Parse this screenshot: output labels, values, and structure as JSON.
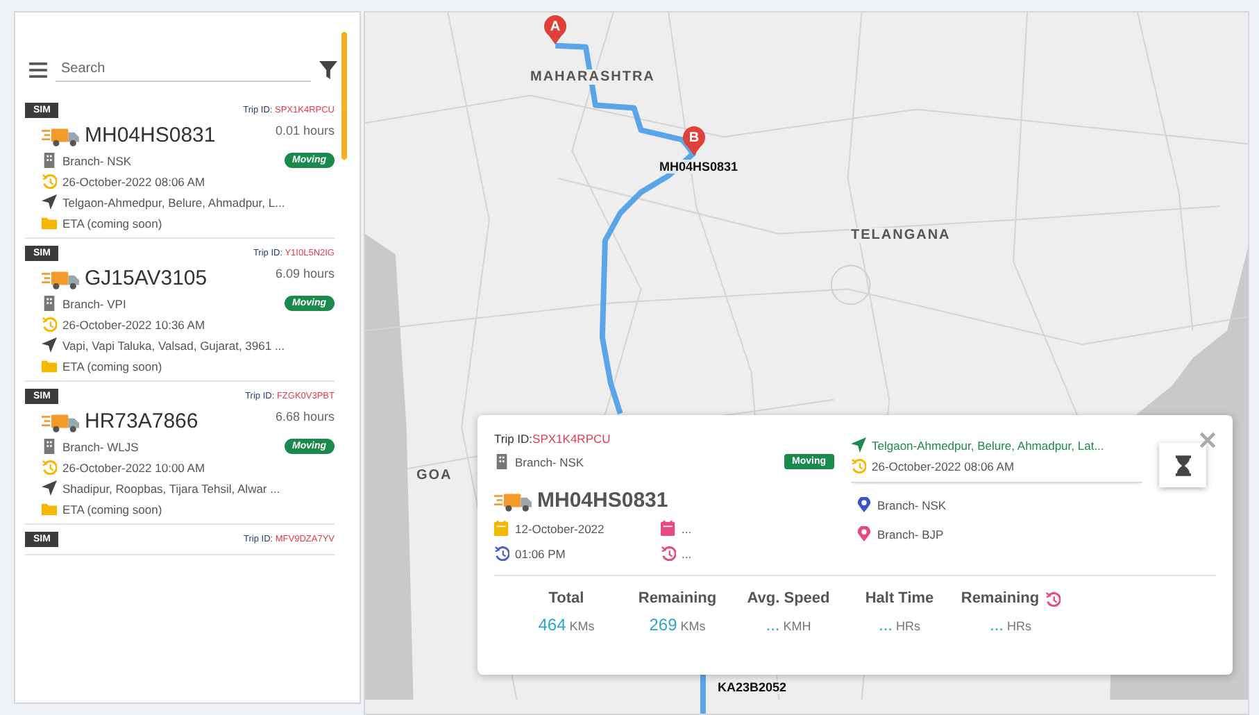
{
  "sidebar": {
    "search": {
      "placeholder": "Search"
    },
    "vehicles": [
      {
        "badge": "SIM",
        "trip_id_label": "Trip ID:",
        "trip_id": "SPX1K4RPCU",
        "plate": "MH04HS0831",
        "duration": "0.01 hours",
        "branch": "Branch- NSK",
        "status": "Moving",
        "datetime": "26-October-2022 08:06 AM",
        "location": "Telgaon-Ahmedpur, Belure, Ahmadpur, L...",
        "eta": "ETA (coming soon)"
      },
      {
        "badge": "SIM",
        "trip_id_label": "Trip ID:",
        "trip_id": "Y1I0L5N2IG",
        "plate": "GJ15AV3105",
        "duration": "6.09 hours",
        "branch": "Branch- VPI",
        "status": "Moving",
        "datetime": "26-October-2022 10:36 AM",
        "location": "Vapi, Vapi Taluka, Valsad, Gujarat, 3961 ...",
        "eta": "ETA (coming soon)"
      },
      {
        "badge": "SIM",
        "trip_id_label": "Trip ID:",
        "trip_id": "FZGK0V3PBT",
        "plate": "HR73A7866",
        "duration": "6.68 hours",
        "branch": "Branch- WLJS",
        "status": "Moving",
        "datetime": "26-October-2022 10:00 AM",
        "location": "Shadipur, Roopbas, Tijara Tehsil, Alwar ...",
        "eta": "ETA (coming soon)"
      },
      {
        "badge": "SIM",
        "trip_id_label": "Trip ID:",
        "trip_id": "MFV9DZA7YV"
      }
    ]
  },
  "map": {
    "region_labels": [
      "MAHARASHTRA",
      "TELANGANA",
      "GOA"
    ],
    "markers": [
      "A",
      "B"
    ],
    "vehicle_labels": [
      "MH04HS0831",
      "KA23B2052"
    ]
  },
  "trip_popup": {
    "trip_id_label": "Trip ID:",
    "trip_id": "SPX1K4RPCU",
    "branch": "Branch- NSK",
    "status": "Moving",
    "location": "Telgaon-Ahmedpur, Belure, Ahmadpur, Lat...",
    "datetime": "26-October-2022 08:06 AM",
    "plate": "MH04HS0831",
    "start_date": "12-October-2022",
    "start_time": "01:06 PM",
    "end_date": "...",
    "end_time": "...",
    "origin": "Branch- NSK",
    "destination": "Branch- BJP",
    "stats": [
      {
        "label": "Total",
        "value": "464",
        "unit": "KMs",
        "label_icon": false
      },
      {
        "label": "Remaining",
        "value": "269",
        "unit": "KMs",
        "label_icon": false
      },
      {
        "label": "Avg. Speed",
        "value": "...",
        "unit": "KMH",
        "label_icon": false
      },
      {
        "label": "Halt Time",
        "value": "...",
        "unit": "HRs",
        "label_icon": false
      },
      {
        "label": "Remaining",
        "value": "...",
        "unit": "HRs",
        "label_icon": true
      }
    ]
  }
}
